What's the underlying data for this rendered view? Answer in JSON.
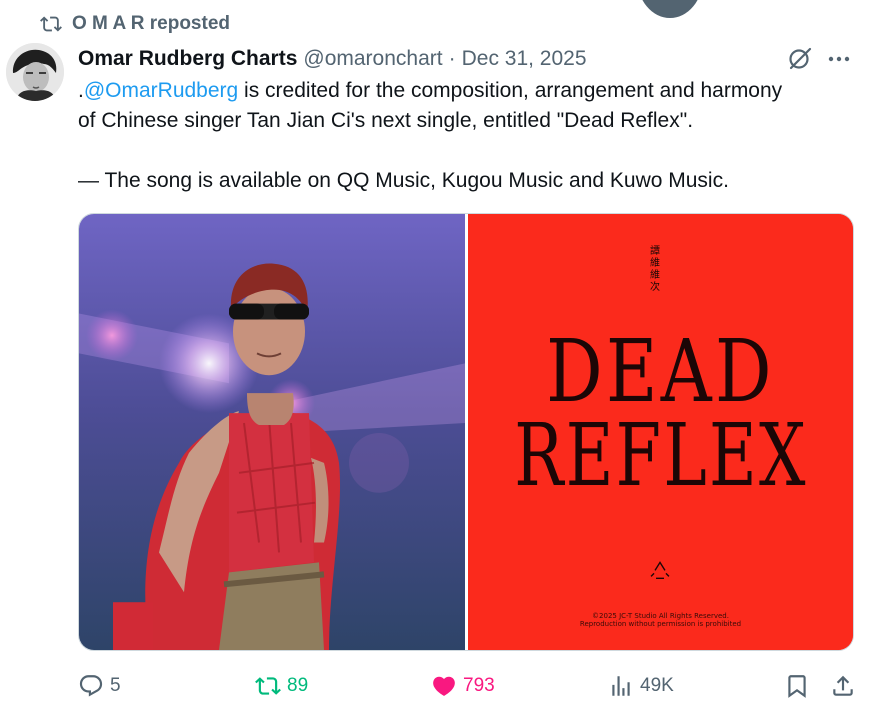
{
  "repost": {
    "label": "O M A R reposted"
  },
  "author": {
    "name": "Omar Rudberg Charts",
    "handle": "@omaronchart",
    "separator": "·",
    "date": "Dec 31, 2025"
  },
  "tweet": {
    "line1_prefix": ".",
    "mention": "@OmarRudberg",
    "line1_rest": " is credited for the composition, arrangement and harmony",
    "line2": "of Chinese singer Tan Jian Ci's next single, entitled \"Dead Reflex\".",
    "line3": "— The song is available on QQ Music, Kugou Music and Kuwo Music."
  },
  "media": {
    "cover": {
      "chinese": "譚維維次",
      "title_line1": "DEAD",
      "title_line2": "REFLEX",
      "copyright_line1": "©2025 JC-T Studio All Rights Reserved.",
      "copyright_line2": "Reproduction without permission is prohibited"
    }
  },
  "actions": {
    "replies": "5",
    "reposts": "89",
    "likes": "793",
    "views": "49K"
  },
  "colors": {
    "text": "#0f1419",
    "secondary": "#536471",
    "link": "#1d9bf0",
    "repost_active": "#00ba7c",
    "like_active": "#f91880",
    "cover_red": "#fb2a1c"
  },
  "icons": [
    "repost-icon",
    "grok-icon",
    "more-icon",
    "reply-icon",
    "like-icon",
    "views-icon",
    "bookmark-icon",
    "share-icon"
  ]
}
